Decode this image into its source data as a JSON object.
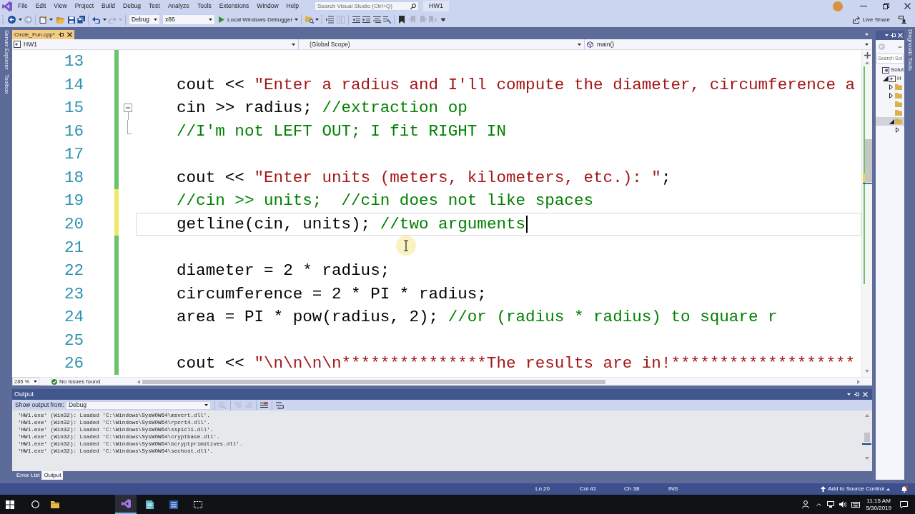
{
  "menu_bar": {
    "items": [
      "File",
      "Edit",
      "View",
      "Project",
      "Build",
      "Debug",
      "Test",
      "Analyze",
      "Tools",
      "Extensions",
      "Window",
      "Help"
    ],
    "search": {
      "placeholder": "Search Visual Studio (Ctrl+Q)"
    },
    "solution_name": "HW1"
  },
  "toolbar": {
    "configuration": "Debug",
    "platform": "x86",
    "start_button": "Local Windows Debugger",
    "live_share": "Live Share"
  },
  "left_dock_tabs": [
    "Server Explorer",
    "Toolbox"
  ],
  "right_dock_tabs": [
    "Diagnostic Tools"
  ],
  "document_tabs": [
    {
      "label": "Circle_Fun.cpp*",
      "selected": true
    }
  ],
  "navigation_bar": {
    "project": "HW1",
    "scope": "(Global Scope)",
    "member": "main()"
  },
  "editor": {
    "lines": [
      {
        "number": "13",
        "unsaved": false,
        "fold_start": false,
        "fold_end": false,
        "current": false
      },
      {
        "number": "14",
        "unsaved": false,
        "fold_start": false,
        "fold_end": false,
        "current": false,
        "tokens": [
          {
            "kind": "code",
            "text": "cout << "
          },
          {
            "kind": "string",
            "text": "\"Enter a radius and I'll compute the diameter, circumference a"
          }
        ]
      },
      {
        "number": "15",
        "unsaved": false,
        "fold_start": true,
        "fold_end": false,
        "current": false,
        "tokens": [
          {
            "kind": "code",
            "text": "cin >> radius; "
          },
          {
            "kind": "comment",
            "text": "//extraction op"
          }
        ]
      },
      {
        "number": "16",
        "unsaved": false,
        "fold_start": false,
        "fold_end": true,
        "current": false,
        "tokens": [
          {
            "kind": "comment",
            "text": "//I'm not LEFT OUT; I fit RIGHT IN"
          }
        ]
      },
      {
        "number": "17",
        "unsaved": false,
        "fold_start": false,
        "fold_end": false,
        "current": false
      },
      {
        "number": "18",
        "unsaved": false,
        "fold_start": false,
        "fold_end": false,
        "current": false,
        "tokens": [
          {
            "kind": "code",
            "text": "cout << "
          },
          {
            "kind": "string",
            "text": "\"Enter units (meters, kilometers, etc.): \""
          },
          {
            "kind": "code",
            "text": ";"
          }
        ]
      },
      {
        "number": "19",
        "unsaved": true,
        "fold_start": false,
        "fold_end": false,
        "current": false,
        "tokens": [
          {
            "kind": "comment",
            "text": "//cin >> units;  //cin does not like spaces"
          }
        ]
      },
      {
        "number": "20",
        "unsaved": true,
        "fold_start": false,
        "fold_end": false,
        "current": true,
        "tokens": [
          {
            "kind": "code",
            "text": "getline(cin, units); "
          },
          {
            "kind": "comment",
            "text": "//two arguments"
          }
        ]
      },
      {
        "number": "21",
        "unsaved": false,
        "fold_start": false,
        "fold_end": false,
        "current": false
      },
      {
        "number": "22",
        "unsaved": false,
        "fold_start": false,
        "fold_end": false,
        "current": false,
        "tokens": [
          {
            "kind": "code",
            "text": "diameter = 2 * radius;"
          }
        ]
      },
      {
        "number": "23",
        "unsaved": false,
        "fold_start": false,
        "fold_end": false,
        "current": false,
        "tokens": [
          {
            "kind": "code",
            "text": "circumference = 2 * PI * radius;"
          }
        ]
      },
      {
        "number": "24",
        "unsaved": false,
        "fold_start": false,
        "fold_end": false,
        "current": false,
        "tokens": [
          {
            "kind": "code",
            "text": "area = PI * pow(radius, 2); "
          },
          {
            "kind": "comment",
            "text": "//or (radius * radius) to square r"
          }
        ]
      },
      {
        "number": "25",
        "unsaved": false,
        "fold_start": false,
        "fold_end": false,
        "current": false
      },
      {
        "number": "26",
        "unsaved": false,
        "fold_start": false,
        "fold_end": false,
        "current": false,
        "tokens": [
          {
            "kind": "code",
            "text": "cout << "
          },
          {
            "kind": "string",
            "text": "\"\\n\\n\\n\\n***************The results are in!*******************"
          }
        ]
      }
    ],
    "zoom": "285 %",
    "issues": "No issues found"
  },
  "solution_explorer": {
    "search": {
      "placeholder": "Search Sol"
    },
    "tree": [
      {
        "label": "Solut",
        "expandable": false,
        "expanded": false,
        "selected": false,
        "children": [
          {
            "label": "H",
            "expandable": true,
            "expanded": true,
            "selected": false,
            "children": [
              {
                "expandable": true,
                "expanded": false,
                "selected": false
              },
              {
                "expandable": true,
                "expanded": false,
                "selected": false
              },
              {
                "expandable": false,
                "expanded": false,
                "selected": false
              },
              {
                "expandable": false,
                "expanded": false,
                "selected": false
              },
              {
                "expandable": true,
                "expanded": true,
                "selected": true,
                "children": [
                  {
                    "expandable": true,
                    "expanded": false,
                    "selected": false
                  }
                ]
              }
            ]
          }
        ]
      }
    ]
  },
  "output": {
    "title": "Output",
    "source_label": "Show output from:",
    "source": "Debug",
    "lines": [
      "'HW1.exe' (Win32): Loaded 'C:\\Windows\\SysWOW64\\msvcrt.dll'.",
      "'HW1.exe' (Win32): Loaded 'C:\\Windows\\SysWOW64\\rpcrt4.dll'.",
      "'HW1.exe' (Win32): Loaded 'C:\\Windows\\SysWOW64\\sspicli.dll'.",
      "'HW1.exe' (Win32): Loaded 'C:\\Windows\\SysWOW64\\cryptbase.dll'.",
      "'HW1.exe' (Win32): Loaded 'C:\\Windows\\SysWOW64\\bcryptprimitives.dll'.",
      "'HW1.exe' (Win32): Loaded 'C:\\Windows\\SysWOW64\\sechost.dll'."
    ]
  },
  "bottom_tabs": [
    {
      "label": "Error List",
      "selected": false
    },
    {
      "label": "Output",
      "selected": true
    }
  ],
  "status_bar": {
    "line": "Ln 20",
    "column": "Col 41",
    "character": "Ch 38",
    "mode": "INS",
    "source_control": "Add to Source Control"
  },
  "taskbar": {
    "time": "11:15 AM",
    "date": "5/30/2019"
  }
}
